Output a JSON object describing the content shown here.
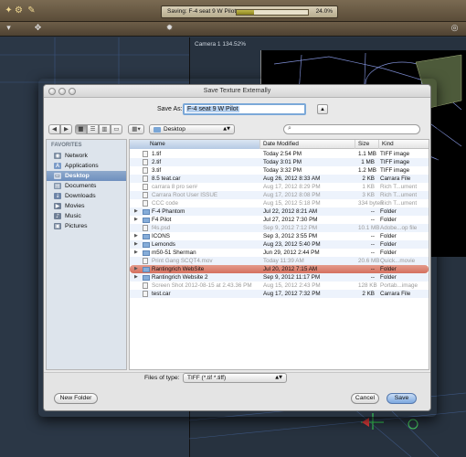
{
  "app": {
    "status_text": "Saving: F-4 seat 9 W Pilot",
    "progress_text": "24.0%",
    "progress_fraction": 0.24,
    "camera_label": "Camera 1 134.52%"
  },
  "dialog": {
    "title": "Save Texture Externally",
    "save_as_label": "Save As:",
    "save_as_value": "F-4 seat 9 W Pilot",
    "location": "Desktop",
    "files_of_type_label": "Files of type:",
    "files_of_type_value": "TIFF (*.tif *.tiff)",
    "new_folder_label": "New Folder",
    "cancel_label": "Cancel",
    "save_label": "Save"
  },
  "sidebar": {
    "header": "FAVORITES",
    "items": [
      {
        "label": "Network",
        "icon": "globe-icon"
      },
      {
        "label": "Applications",
        "icon": "applications-icon"
      },
      {
        "label": "Desktop",
        "icon": "desktop-icon"
      },
      {
        "label": "Documents",
        "icon": "documents-icon"
      },
      {
        "label": "Downloads",
        "icon": "downloads-icon"
      },
      {
        "label": "Movies",
        "icon": "movies-icon"
      },
      {
        "label": "Music",
        "icon": "music-icon"
      },
      {
        "label": "Pictures",
        "icon": "pictures-icon"
      }
    ]
  },
  "columns": {
    "name": "Name",
    "date": "Date Modified",
    "size": "Size",
    "kind": "Kind"
  },
  "files": [
    {
      "name": "1.tif",
      "date": "Today 2:54 PM",
      "size": "1.1 MB",
      "kind": "TIFF image"
    },
    {
      "name": "2.tif",
      "date": "Today 3:01 PM",
      "size": "1 MB",
      "kind": "TIFF image"
    },
    {
      "name": "3.tif",
      "date": "Today 3:32 PM",
      "size": "1.2 MB",
      "kind": "TIFF image"
    },
    {
      "name": "8.5 teat.car",
      "date": "Aug 26, 2012 8:33 AM",
      "size": "2 KB",
      "kind": "Carrara File"
    },
    {
      "name": "carrara 8 pro ser#",
      "date": "Aug 17, 2012 8:29 PM",
      "size": "1 KB",
      "kind": "Rich T...ument"
    },
    {
      "name": "Carrara Root User ISSUE",
      "date": "Aug 17, 2012 8:08 PM",
      "size": "3 KB",
      "kind": "Rich T...ument"
    },
    {
      "name": "CCC code",
      "date": "Aug 15, 2012 5:18 PM",
      "size": "334 bytes",
      "kind": "Rich T...ument"
    },
    {
      "name": "F-4 Phantom",
      "date": "Jul 22, 2012 8:21 AM",
      "size": "--",
      "kind": "Folder"
    },
    {
      "name": "F4 Pilot",
      "date": "Jul 27, 2012 7:30 PM",
      "size": "--",
      "kind": "Folder"
    },
    {
      "name": "f4s.psd",
      "date": "Sep 9, 2012 7:12 PM",
      "size": "10.1 MB",
      "kind": "Adobe...op file"
    },
    {
      "name": "ICONS",
      "date": "Sep 3, 2012 3:55 PM",
      "size": "--",
      "kind": "Folder"
    },
    {
      "name": "Lemonds",
      "date": "Aug 23, 2012 5:40 PM",
      "size": "--",
      "kind": "Folder"
    },
    {
      "name": "m50-51 Sherman",
      "date": "Jun 29, 2012 2:44 PM",
      "size": "--",
      "kind": "Folder"
    },
    {
      "name": "Print Gang SCQT4.mov",
      "date": "Today 11:39 AM",
      "size": "20.6 MB",
      "kind": "Quick...movie"
    },
    {
      "name": "Rantingrich WebSite",
      "date": "Jul 20, 2012 7:15 AM",
      "size": "--",
      "kind": "Folder"
    },
    {
      "name": "Rantingrich Website 2",
      "date": "Sep 9, 2012 11:17 PM",
      "size": "--",
      "kind": "Folder"
    },
    {
      "name": "Screen Shot 2012-08-15 at 2.43.36 PM",
      "date": "Aug 15, 2012 2:43 PM",
      "size": "128 KB",
      "kind": "Portab...image"
    },
    {
      "name": "test.car",
      "date": "Aug 17, 2012 7:32 PM",
      "size": "2 KB",
      "kind": "Carrara File"
    }
  ]
}
